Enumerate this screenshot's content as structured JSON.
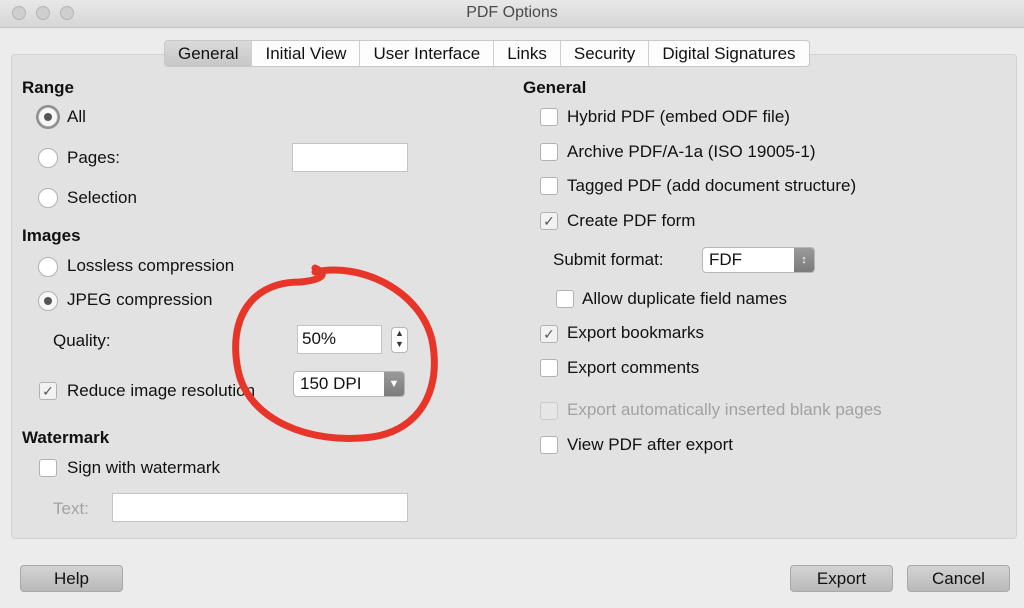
{
  "window": {
    "title": "PDF Options"
  },
  "tabs": [
    {
      "label": "General",
      "active": true
    },
    {
      "label": "Initial View",
      "active": false
    },
    {
      "label": "User Interface",
      "active": false
    },
    {
      "label": "Links",
      "active": false
    },
    {
      "label": "Security",
      "active": false
    },
    {
      "label": "Digital Signatures",
      "active": false
    }
  ],
  "range": {
    "heading": "Range",
    "all_label": "All",
    "pages_label": "Pages:",
    "pages_value": "",
    "selection_label": "Selection",
    "selected": "All"
  },
  "images": {
    "heading": "Images",
    "lossless_label": "Lossless compression",
    "jpeg_label": "JPEG compression",
    "selected": "JPEG compression",
    "quality_label": "Quality:",
    "quality_value": "50%",
    "reduce_label": "Reduce image resolution",
    "reduce_checked": true,
    "resolution_value": "150 DPI"
  },
  "watermark": {
    "heading": "Watermark",
    "sign_label": "Sign with watermark",
    "sign_checked": false,
    "text_label": "Text:",
    "text_value": ""
  },
  "general": {
    "heading": "General",
    "hybrid_label": "Hybrid PDF (embed ODF file)",
    "archive_label": "Archive PDF/A-1a (ISO 19005-1)",
    "tagged_label": "Tagged PDF (add document structure)",
    "create_form_label": "Create PDF form",
    "create_form_checked": true,
    "submit_format_label": "Submit format:",
    "submit_format_value": "FDF",
    "allow_duplicate_label": "Allow duplicate field names",
    "export_bookmarks_label": "Export bookmarks",
    "export_bookmarks_checked": true,
    "export_comments_label": "Export comments",
    "export_blank_label": "Export automatically inserted blank pages",
    "view_after_label": "View PDF after export"
  },
  "buttons": {
    "help": "Help",
    "export": "Export",
    "cancel": "Cancel"
  },
  "annotation": {
    "color": "#e8352a",
    "shape": "hand-drawn circle around quality and resolution controls"
  }
}
